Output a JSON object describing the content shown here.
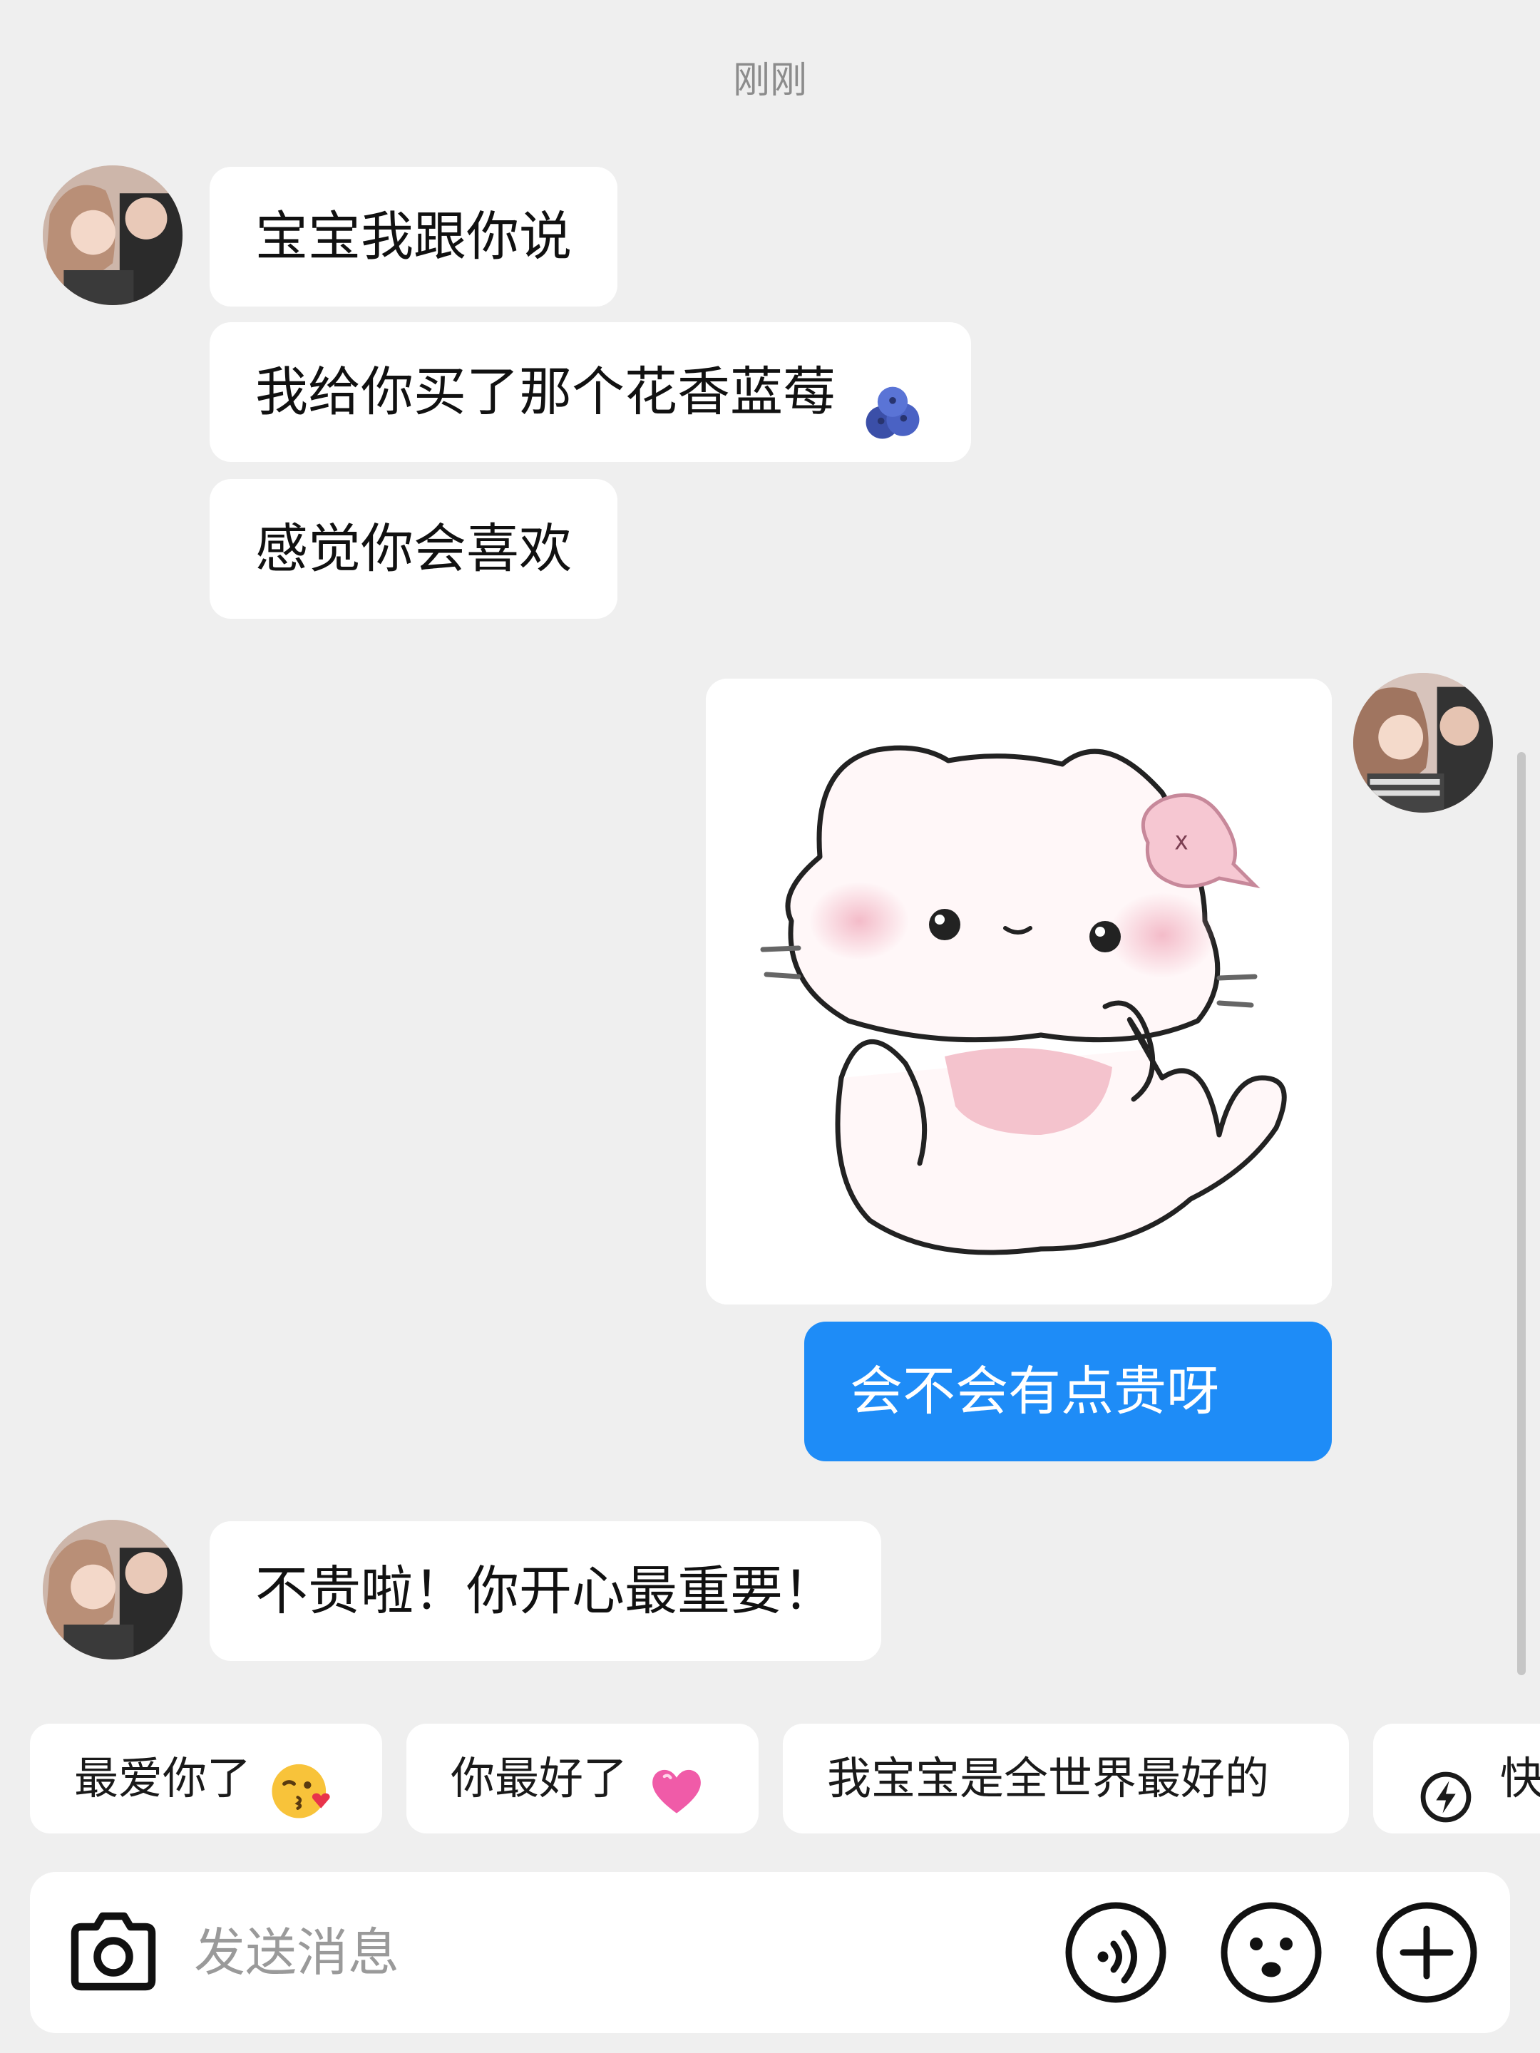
{
  "chat": {
    "timestamp": "刚刚",
    "messages": [
      {
        "from": "other",
        "text": "宝宝我跟你说"
      },
      {
        "from": "other",
        "text": "我给你买了那个花香蓝莓"
      },
      {
        "from": "other",
        "text": "感觉你会喜欢"
      },
      {
        "from": "me",
        "type": "sticker",
        "icon": "cat-sticker"
      },
      {
        "from": "me",
        "text": "会不会有点贵呀"
      },
      {
        "from": "other",
        "text": "不贵啦！你开心最重要！"
      }
    ]
  },
  "quick_replies": [
    {
      "label": "最爱你了",
      "emoji": "kissing-face-with-heart"
    },
    {
      "label": "你最好了",
      "emoji": "sparkling-heart"
    },
    {
      "label": "我宝宝是全世界最好的"
    },
    {
      "label": "快",
      "icon": "lightning-icon"
    }
  ],
  "input": {
    "placeholder": "发送消息",
    "icons": [
      "camera-icon",
      "voice-icon",
      "emoji-icon",
      "plus-icon"
    ]
  },
  "colors": {
    "background": "#efefef",
    "bubble_other": "#ffffff",
    "bubble_mine": "#1e8cf7",
    "scrollbar": "#c6c6c6"
  }
}
